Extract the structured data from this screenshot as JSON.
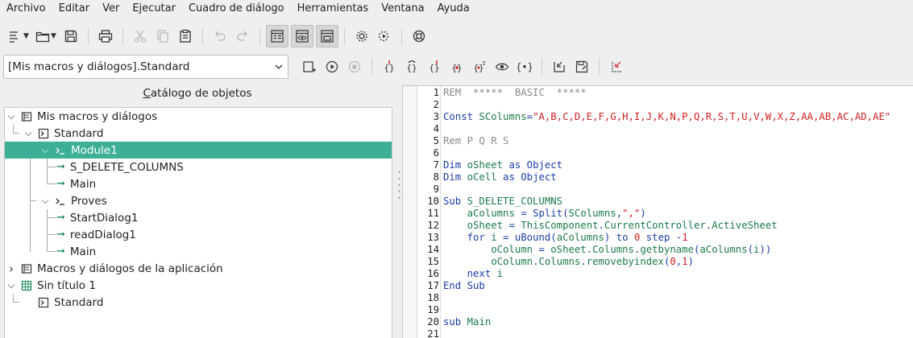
{
  "menu": [
    "Archivo",
    "Editar",
    "Ver",
    "Ejecutar",
    "Cuadro de diálogo",
    "Herramientas",
    "Ventana",
    "Ayuda"
  ],
  "library_selector": {
    "value": "[Mis macros y diálogos].Standard"
  },
  "catalog": {
    "title": "Catálogo de objetos",
    "title_underline_char": "C",
    "items": [
      {
        "label": "Mis macros y diálogos",
        "icon": "library-icon",
        "expanded": true
      },
      {
        "label": "Standard",
        "icon": "basic-library-icon",
        "expanded": true
      },
      {
        "label": "Module1",
        "icon": "module-icon",
        "expanded": true,
        "selected": true
      },
      {
        "label": "S_DELETE_COLUMNS",
        "icon": "arrow-right-icon"
      },
      {
        "label": "Main",
        "icon": "arrow-right-icon"
      },
      {
        "label": "Proves",
        "icon": "module-icon",
        "expanded": true
      },
      {
        "label": "StartDialog1",
        "icon": "arrow-right-icon"
      },
      {
        "label": "readDialog1",
        "icon": "arrow-right-icon"
      },
      {
        "label": "Main",
        "icon": "arrow-right-icon"
      },
      {
        "label": "Macros y diálogos de la aplicación",
        "icon": "library-icon",
        "expanded": false
      },
      {
        "label": "Sin título 1",
        "icon": "spreadsheet-icon",
        "expanded": true
      },
      {
        "label": "Standard",
        "icon": "basic-library-icon"
      }
    ]
  },
  "editor": {
    "lines": [
      {
        "n": "1",
        "tokens": [
          [
            "cm",
            "REM  *****  BASIC  *****"
          ]
        ]
      },
      {
        "n": "2",
        "tokens": []
      },
      {
        "n": "3",
        "tokens": [
          [
            "kw",
            "Const "
          ],
          [
            "id",
            "SColumns"
          ],
          [
            "op",
            "="
          ],
          [
            "st",
            "\"A,B,C,D,E,F,G,H,I,J,K,N,P,Q,R,S,T,U,V,W,X,Z,AA,AB,AC,AD,AE\""
          ]
        ]
      },
      {
        "n": "4",
        "tokens": []
      },
      {
        "n": "5",
        "tokens": [
          [
            "cm",
            "Rem P Q R S"
          ]
        ]
      },
      {
        "n": "6",
        "tokens": []
      },
      {
        "n": "7",
        "tokens": [
          [
            "kw",
            "Dim "
          ],
          [
            "id",
            "oSheet"
          ],
          [
            "kw",
            " as Object"
          ]
        ]
      },
      {
        "n": "8",
        "tokens": [
          [
            "kw",
            "Dim "
          ],
          [
            "id",
            "oCell"
          ],
          [
            "kw",
            " as Object"
          ]
        ]
      },
      {
        "n": "9",
        "tokens": []
      },
      {
        "n": "10",
        "tokens": [
          [
            "kw",
            "Sub "
          ],
          [
            "id",
            "S_DELETE_COLUMNS"
          ]
        ]
      },
      {
        "n": "11",
        "tokens": [
          [
            "kw",
            "    "
          ],
          [
            "id",
            "aColumns"
          ],
          [
            "op",
            " = "
          ],
          [
            "kw",
            "Split"
          ],
          [
            "op",
            "("
          ],
          [
            "id",
            "SColumns"
          ],
          [
            "op",
            ","
          ],
          [
            "st",
            "\",\""
          ],
          [
            "op",
            ")"
          ]
        ]
      },
      {
        "n": "12",
        "tokens": [
          [
            "kw",
            "    "
          ],
          [
            "id",
            "oSheet"
          ],
          [
            "op",
            " = "
          ],
          [
            "id",
            "ThisComponent"
          ],
          [
            "op",
            "."
          ],
          [
            "id",
            "CurrentController"
          ],
          [
            "op",
            "."
          ],
          [
            "id",
            "ActiveSheet"
          ]
        ]
      },
      {
        "n": "13",
        "tokens": [
          [
            "kw",
            "    for "
          ],
          [
            "id",
            "i"
          ],
          [
            "op",
            " = "
          ],
          [
            "kw",
            "uBound"
          ],
          [
            "op",
            "("
          ],
          [
            "id",
            "aColumns"
          ],
          [
            "op",
            ") "
          ],
          [
            "kw",
            "to "
          ],
          [
            "nm",
            "0"
          ],
          [
            "kw",
            " step "
          ],
          [
            "op",
            "-"
          ],
          [
            "nm",
            "1"
          ]
        ]
      },
      {
        "n": "14",
        "tokens": [
          [
            "kw",
            "        "
          ],
          [
            "id",
            "oColumn"
          ],
          [
            "op",
            " = "
          ],
          [
            "id",
            "oSheet"
          ],
          [
            "op",
            "."
          ],
          [
            "id",
            "Columns"
          ],
          [
            "op",
            "."
          ],
          [
            "id",
            "getbyname"
          ],
          [
            "op",
            "("
          ],
          [
            "id",
            "aColumns"
          ],
          [
            "op",
            "("
          ],
          [
            "id",
            "i"
          ],
          [
            "op",
            "))"
          ]
        ]
      },
      {
        "n": "15",
        "tokens": [
          [
            "kw",
            "        "
          ],
          [
            "id",
            "oColumn"
          ],
          [
            "op",
            "."
          ],
          [
            "id",
            "Columns"
          ],
          [
            "op",
            "."
          ],
          [
            "id",
            "removebyindex"
          ],
          [
            "op",
            "("
          ],
          [
            "nm",
            "0"
          ],
          [
            "op",
            ","
          ],
          [
            "nm",
            "1"
          ],
          [
            "op",
            ")"
          ]
        ]
      },
      {
        "n": "16",
        "tokens": [
          [
            "kw",
            "    next "
          ],
          [
            "id",
            "i"
          ]
        ]
      },
      {
        "n": "17",
        "tokens": [
          [
            "kw",
            "End Sub"
          ]
        ]
      },
      {
        "n": "18",
        "tokens": []
      },
      {
        "n": "19",
        "tokens": []
      },
      {
        "n": "20",
        "tokens": [
          [
            "kw",
            "sub "
          ],
          [
            "id",
            "Main"
          ]
        ]
      },
      {
        "n": "21",
        "tokens": []
      }
    ]
  },
  "colors": {
    "selection": "#3daf96",
    "keyword": "#1a3ea8",
    "string": "#d12020",
    "identifier": "#1a7a4a",
    "comment": "#8a8a8a"
  }
}
